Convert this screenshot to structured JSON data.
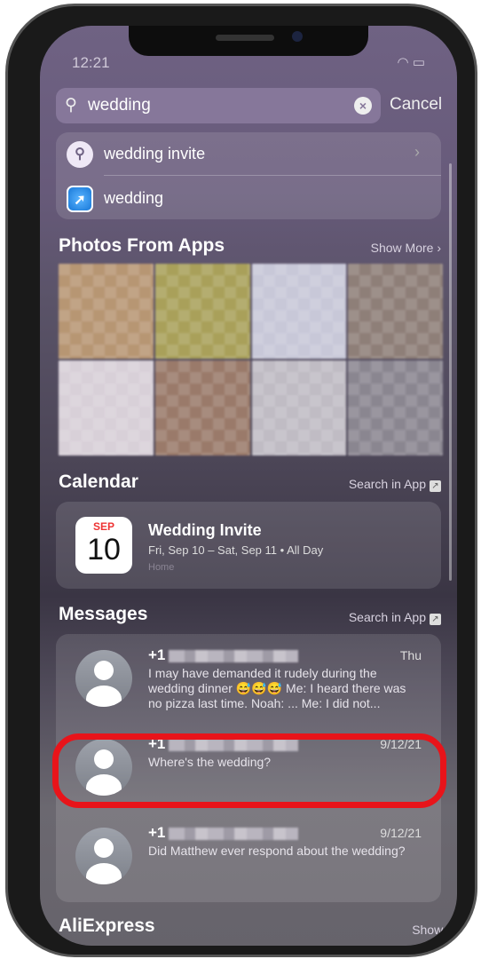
{
  "status": {
    "time": "12:21"
  },
  "search": {
    "query": "wedding",
    "cancel": "Cancel"
  },
  "suggestions": [
    {
      "label": "wedding invite",
      "icon": "search-icon"
    },
    {
      "label": "wedding",
      "icon": "safari-icon"
    }
  ],
  "photos": {
    "title": "Photos From Apps",
    "show_more": "Show More ›",
    "tile_colors": [
      "#b79673",
      "#a9a05a",
      "#c8c8d8",
      "#8e7f78",
      "#d8d0d8",
      "#9a7a6a",
      "#c0bcc4",
      "#8a8690"
    ]
  },
  "calendar": {
    "title": "Calendar",
    "search_in_app": "Search in App",
    "event": {
      "month": "SEP",
      "day": "10",
      "title": "Wedding Invite",
      "when": "Fri, Sep 10 – Sat, Sep 11 • All Day",
      "calendar": "Home"
    }
  },
  "messages": {
    "title": "Messages",
    "search_in_app": "Search in App",
    "items": [
      {
        "from": "+1",
        "date": "Thu",
        "text": "I may have demanded it rudely during the wedding dinner 😅😅😅 Me: I heard there was no pizza last time. Noah: ... Me: I did not..."
      },
      {
        "from": "+1",
        "date": "9/12/21",
        "text": "Where's the wedding?"
      },
      {
        "from": "+1",
        "date": "9/12/21",
        "text": "Did Matthew ever respond about the wedding?"
      }
    ]
  },
  "next_section": {
    "title": "AliExpress",
    "show_more": "Show More"
  },
  "highlight_color": "#e8141a"
}
